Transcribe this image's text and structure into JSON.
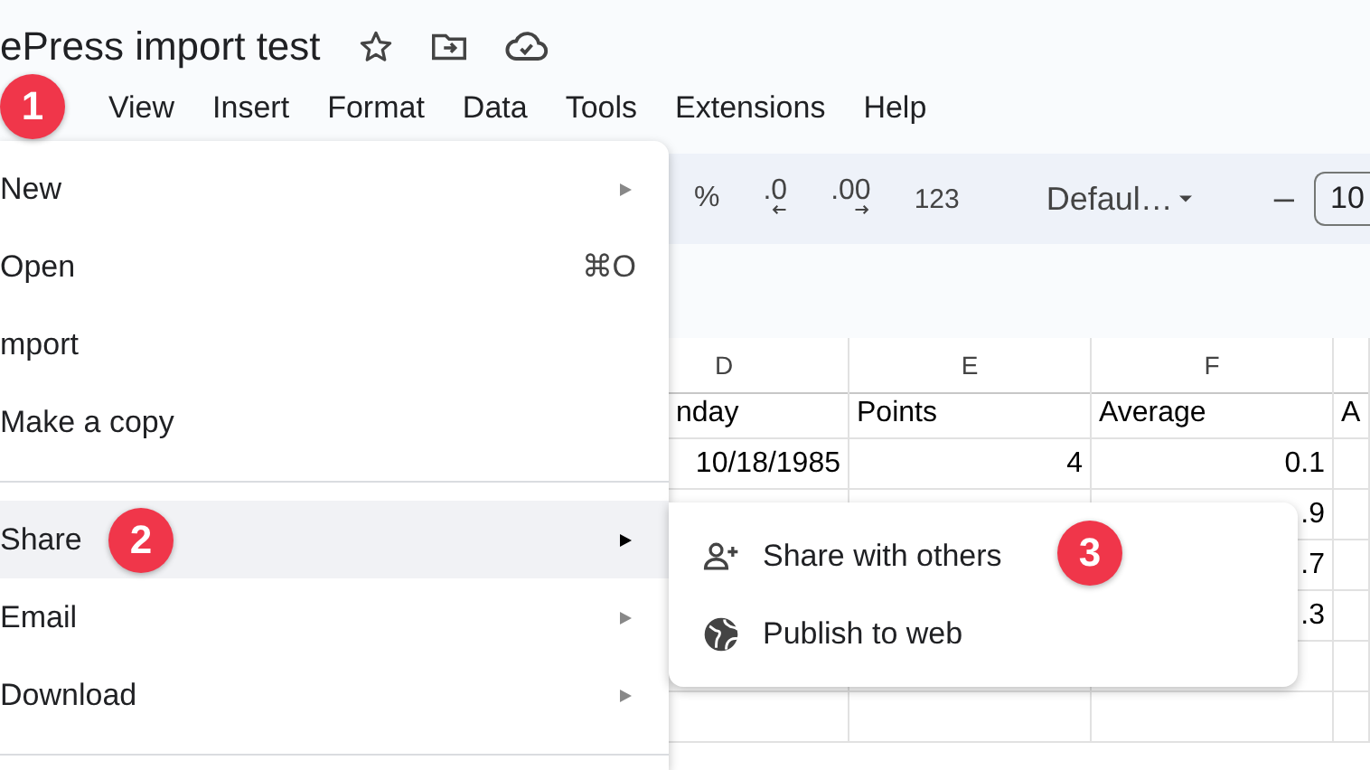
{
  "document": {
    "title": "ePress import test"
  },
  "menubar": [
    {
      "label": "View"
    },
    {
      "label": "Insert"
    },
    {
      "label": "Format"
    },
    {
      "label": "Data"
    },
    {
      "label": "Tools"
    },
    {
      "label": "Extensions"
    },
    {
      "label": "Help"
    }
  ],
  "toolbar": [
    {
      "kind": "percent",
      "label": "%"
    },
    {
      "kind": "decrease-decimal",
      "label": ".0"
    },
    {
      "kind": "increase-decimal",
      "label": ".00"
    },
    {
      "kind": "format",
      "label": "123"
    },
    {
      "kind": "divider"
    },
    {
      "kind": "font",
      "label": "Defaul…"
    },
    {
      "kind": "divider"
    },
    {
      "kind": "minus",
      "label": "–"
    },
    {
      "kind": "size",
      "label": "10"
    }
  ],
  "sheet": {
    "columns": [
      "D",
      "E",
      "F"
    ],
    "rows": [
      [
        {
          "kind": "text",
          "text": "nday"
        },
        {
          "kind": "text",
          "text": "Points"
        },
        {
          "kind": "text",
          "text": "Average"
        },
        {
          "kind": "text",
          "text": "A"
        }
      ],
      [
        {
          "kind": "number",
          "text": "10/18/1985"
        },
        {
          "kind": "number",
          "text": "4"
        },
        {
          "kind": "number",
          "text": "0.1"
        },
        null
      ],
      [
        null,
        null,
        {
          "kind": "number",
          "text": ".9"
        },
        null
      ],
      [
        null,
        null,
        {
          "kind": "number",
          "text": ".7"
        },
        null
      ],
      [
        null,
        null,
        {
          "kind": "number",
          "text": ".3"
        },
        null
      ]
    ]
  },
  "file_menu": [
    {
      "kind": "submenu",
      "label": "New",
      "selected": false
    },
    {
      "kind": "shortcut",
      "label": "Open",
      "shortcut": "⌘O",
      "selected": false
    },
    {
      "kind": "plain",
      "label": "mport",
      "selected": false
    },
    {
      "kind": "plain",
      "label": "Make a copy",
      "selected": false
    },
    {
      "kind": "divider"
    },
    {
      "kind": "submenu",
      "label": "Share",
      "selected": true
    },
    {
      "kind": "submenu",
      "label": "Email",
      "selected": false
    },
    {
      "kind": "submenu",
      "label": "Download",
      "selected": false
    },
    {
      "kind": "divider"
    }
  ],
  "share_submenu": [
    {
      "label": "Share with others"
    },
    {
      "label": "Publish to web"
    }
  ],
  "callouts": [
    {
      "label": "1"
    },
    {
      "label": "2"
    },
    {
      "label": "3"
    }
  ]
}
